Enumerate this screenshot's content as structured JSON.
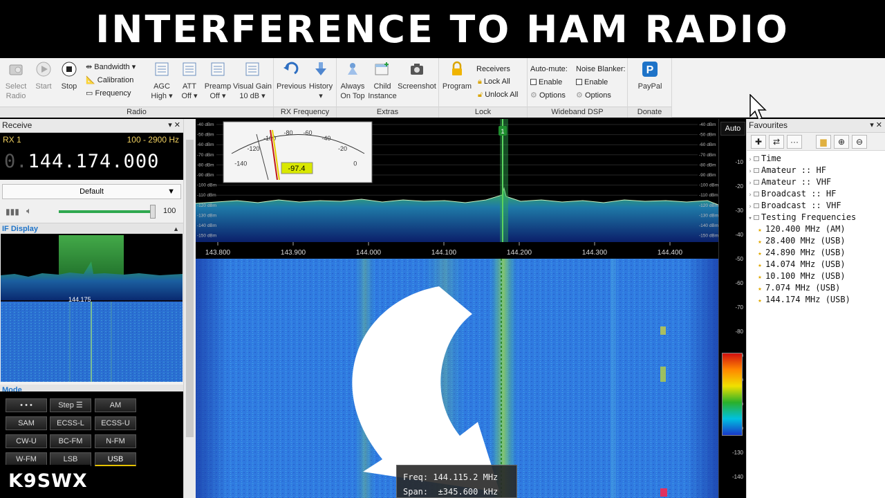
{
  "banner": {
    "title": "INTERFERENCE TO HAM RADIO"
  },
  "ribbon": {
    "radio": {
      "label": "Radio",
      "select_radio": [
        "Select",
        "Radio"
      ],
      "start": "Start",
      "stop": "Stop",
      "bandwidth": "Bandwidth",
      "calibration": "Calibration",
      "frequency": "Frequency",
      "agc": [
        "AGC",
        "High"
      ],
      "att": [
        "ATT",
        "Off"
      ],
      "preamp": [
        "Preamp",
        "Off"
      ],
      "visual_gain": [
        "Visual Gain",
        "10 dB"
      ]
    },
    "rx_frequency": {
      "label": "RX Frequency",
      "previous": "Previous",
      "history": "History"
    },
    "extras": {
      "label": "Extras",
      "always_on_top": [
        "Always",
        "On Top"
      ],
      "child_instance": [
        "Child",
        "Instance"
      ],
      "screenshot": "Screenshot"
    },
    "lock": {
      "label": "Lock",
      "program": "Program",
      "receivers": "Receivers",
      "lock_all": "Lock All",
      "unlock_all": "Unlock All"
    },
    "wideband_dsp": {
      "label": "Wideband DSP",
      "auto_mute": "Auto-mute:",
      "noise_blanker": "Noise Blanker:",
      "enable": "Enable",
      "options": "Options"
    },
    "donate": {
      "label": "Donate",
      "paypal": "PayPal"
    }
  },
  "receive": {
    "title": "Receive",
    "rx_name": "RX 1",
    "bandwidth_range": "100 - 2900 Hz",
    "freq_dim": "0.",
    "freq_value": "144.174.000",
    "profile": "Default",
    "volume_value": "100",
    "volume_level": 0.97,
    "if_display_title": "IF Display",
    "if_center_label": "144.175",
    "mode_title": "Mode"
  },
  "modes": [
    "• • •",
    "Step ☰",
    "AM",
    "SAM",
    "ECSS-L",
    "ECSS-U",
    "CW-U",
    "BC-FM",
    "N-FM",
    "W-FM",
    "LSB",
    "USB"
  ],
  "mode_selected": "USB",
  "spectrum": {
    "meter_scale": [
      "-140",
      "-120",
      "-100",
      "-80",
      "-60",
      "-40",
      "-20",
      "0"
    ],
    "meter_reading": "-97.4",
    "dbm_labels": [
      "-40 dBm",
      "-50 dBm",
      "-60 dBm",
      "-70 dBm",
      "-80 dBm",
      "-90 dBm",
      "-100 dBm",
      "-110 dBm",
      "-120 dBm",
      "-130 dBm",
      "-140 dBm",
      "-150 dBm"
    ],
    "freq_axis": [
      "143.800",
      "143.900",
      "144.000",
      "144.100",
      "144.200",
      "144.300",
      "144.400"
    ],
    "marker_label": "1"
  },
  "right_scale": {
    "auto": "Auto",
    "levels": [
      "-10",
      "-20",
      "-30",
      "-40",
      "-50",
      "-60",
      "-70",
      "-80",
      "-90",
      "-100",
      "-110",
      "-120",
      "-130",
      "-140"
    ]
  },
  "favourites": {
    "title": "Favourites",
    "folders": [
      "Time",
      "Amateur :: HF",
      "Amateur :: VHF",
      "Broadcast :: HF",
      "Broadcast :: VHF",
      "Testing Frequencies"
    ],
    "items": [
      "120.400 MHz (AM)",
      "28.400 MHz (USB)",
      "24.890 MHz (USB)",
      "14.074 MHz (USB)",
      "10.100 MHz (USB)",
      "7.074 MHz (USB)",
      "144.174 MHz (USB)"
    ]
  },
  "tooltip": {
    "freq_label": "Freq:",
    "freq_value": "144.115.2 MHz",
    "span_label": "Span:",
    "span_value": "±345.600 kHz"
  },
  "watermark": "K9SWX",
  "colors": {
    "accent_blue": "#1e73c8",
    "spectrum_green": "#2fa84f",
    "waterfall_blue": "#2b6fd6",
    "mode_active": "#e6c200"
  }
}
